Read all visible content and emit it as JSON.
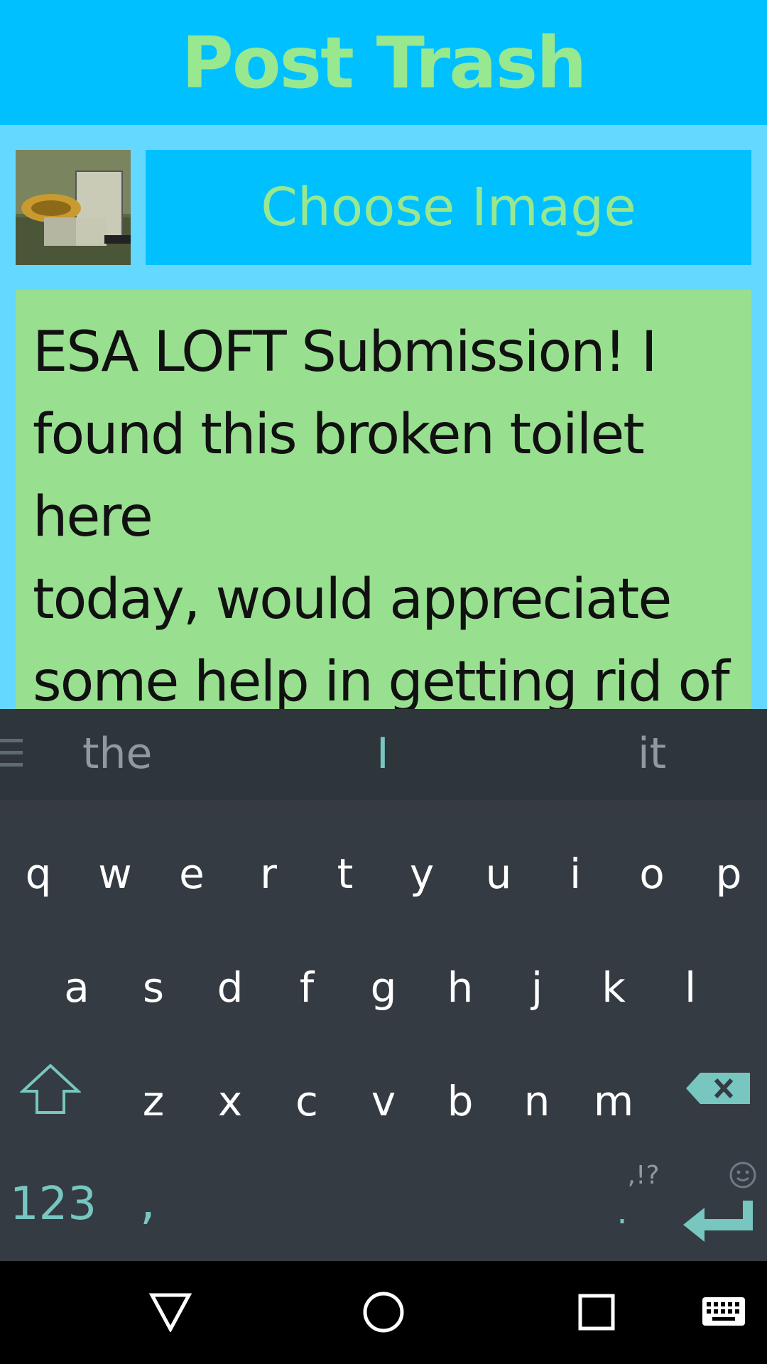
{
  "header": {
    "title": "Post Trash"
  },
  "image_picker": {
    "thumbnail_alt": "toilet photo",
    "choose_label": "Choose Image"
  },
  "description": {
    "value": "ESA LOFT Submission! I\nfound this broken toilet here\ntoday, would appreciate\nsome help in getting rid of it!"
  },
  "keyboard": {
    "suggestions": [
      "the",
      "I",
      "it"
    ],
    "row1": [
      "q",
      "w",
      "e",
      "r",
      "t",
      "y",
      "u",
      "i",
      "o",
      "p"
    ],
    "row2": [
      "a",
      "s",
      "d",
      "f",
      "g",
      "h",
      "j",
      "k",
      "l"
    ],
    "row3": [
      "z",
      "x",
      "c",
      "v",
      "b",
      "n",
      "m"
    ],
    "numbers_label": "123",
    "comma_label": ",",
    "period_label": ".",
    "punct_label": ",!?"
  },
  "colors": {
    "header_bg": "#00c0ff",
    "title_green": "#98e890",
    "textarea_bg": "#98e090",
    "page_bg": "#64d8ff",
    "keyboard_bg": "#353b42",
    "accent_teal": "#77c6c0"
  }
}
